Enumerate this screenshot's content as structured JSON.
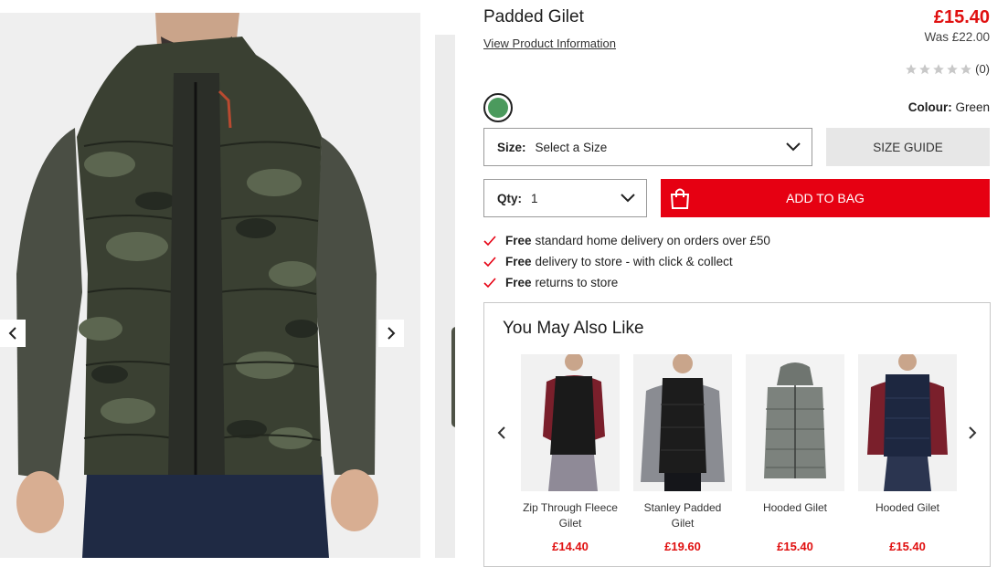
{
  "product": {
    "title": "Padded Gilet",
    "view_info_link": "View Product Information",
    "price": "£15.40",
    "was_price": "Was £22.00",
    "rating_count": "(0)",
    "rating_value": 0,
    "colour_label": "Colour:",
    "colour_value": "Green",
    "swatch_color": "#4b9a5d"
  },
  "size_select": {
    "label": "Size:",
    "value": "Select a Size"
  },
  "size_guide_label": "SIZE GUIDE",
  "qty_select": {
    "label": "Qty:",
    "value": "1"
  },
  "add_to_bag_label": "ADD TO BAG",
  "benefits": [
    {
      "bold": "Free",
      "text": "standard home delivery on orders over £50"
    },
    {
      "bold": "Free",
      "text": "delivery to store - with click & collect"
    },
    {
      "bold": "Free",
      "text": "returns to store"
    }
  ],
  "recommendations": {
    "title": "You May Also Like",
    "items": [
      {
        "name": "Zip Through Fleece Gilet",
        "price": "£14.40"
      },
      {
        "name": "Stanley Padded Gilet",
        "price": "£19.60"
      },
      {
        "name": "Hooded Gilet",
        "price": "£15.40"
      },
      {
        "name": "Hooded Gilet",
        "price": "£15.40"
      }
    ]
  },
  "colors": {
    "accent": "#e60012",
    "price": "#e01010",
    "camo_dark": "#2e3328",
    "camo_mid": "#5c6650",
    "fleece": "#4a4e44"
  },
  "icons": [
    "chevron-left-icon",
    "chevron-right-icon",
    "star-icon",
    "chevron-down-icon",
    "shopping-bag-icon",
    "check-icon"
  ]
}
